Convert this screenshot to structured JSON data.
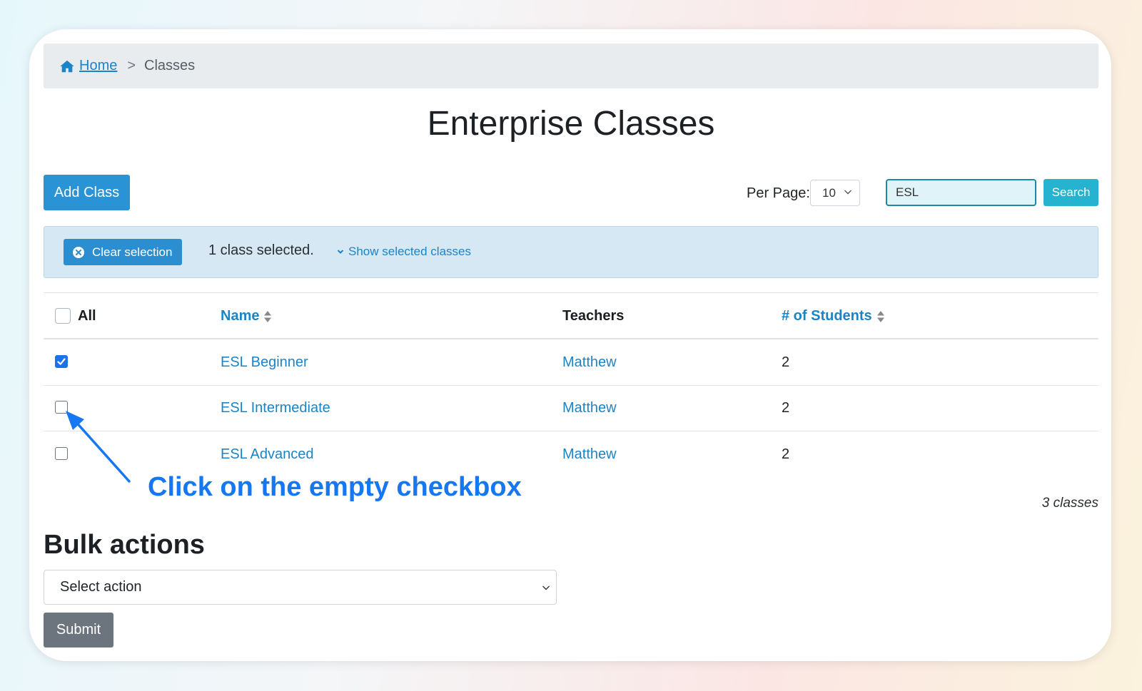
{
  "breadcrumb": {
    "home_label": "Home",
    "separator": ">",
    "current": "Classes"
  },
  "page_title": "Enterprise Classes",
  "toolbar": {
    "add_label": "Add Class",
    "per_page_label": "Per Page:",
    "per_page_value": "10",
    "search_value": "ESL",
    "search_label": "Search"
  },
  "selection": {
    "clear_label": "Clear selection",
    "status_text": "1 class selected.",
    "show_label": "Show selected classes"
  },
  "table": {
    "headers": {
      "all": "All",
      "name": "Name",
      "teachers": "Teachers",
      "students": "# of Students"
    },
    "rows": [
      {
        "name": "ESL Beginner",
        "teacher": "Matthew",
        "students": "2",
        "checked": true
      },
      {
        "name": "ESL Intermediate",
        "teacher": "Matthew",
        "students": "2",
        "checked": false
      },
      {
        "name": "ESL Advanced",
        "teacher": "Matthew",
        "students": "2",
        "checked": false
      }
    ],
    "count_text": "3 classes"
  },
  "annotation": {
    "text": "Click on the empty checkbox",
    "color": "#1677f2"
  },
  "bulk": {
    "title": "Bulk actions",
    "select_value": "Select action",
    "submit_label": "Submit"
  },
  "colors": {
    "link": "#1b84c6",
    "primary": "#2a93d5",
    "info": "#25b3cf",
    "secondary": "#6c757d"
  }
}
